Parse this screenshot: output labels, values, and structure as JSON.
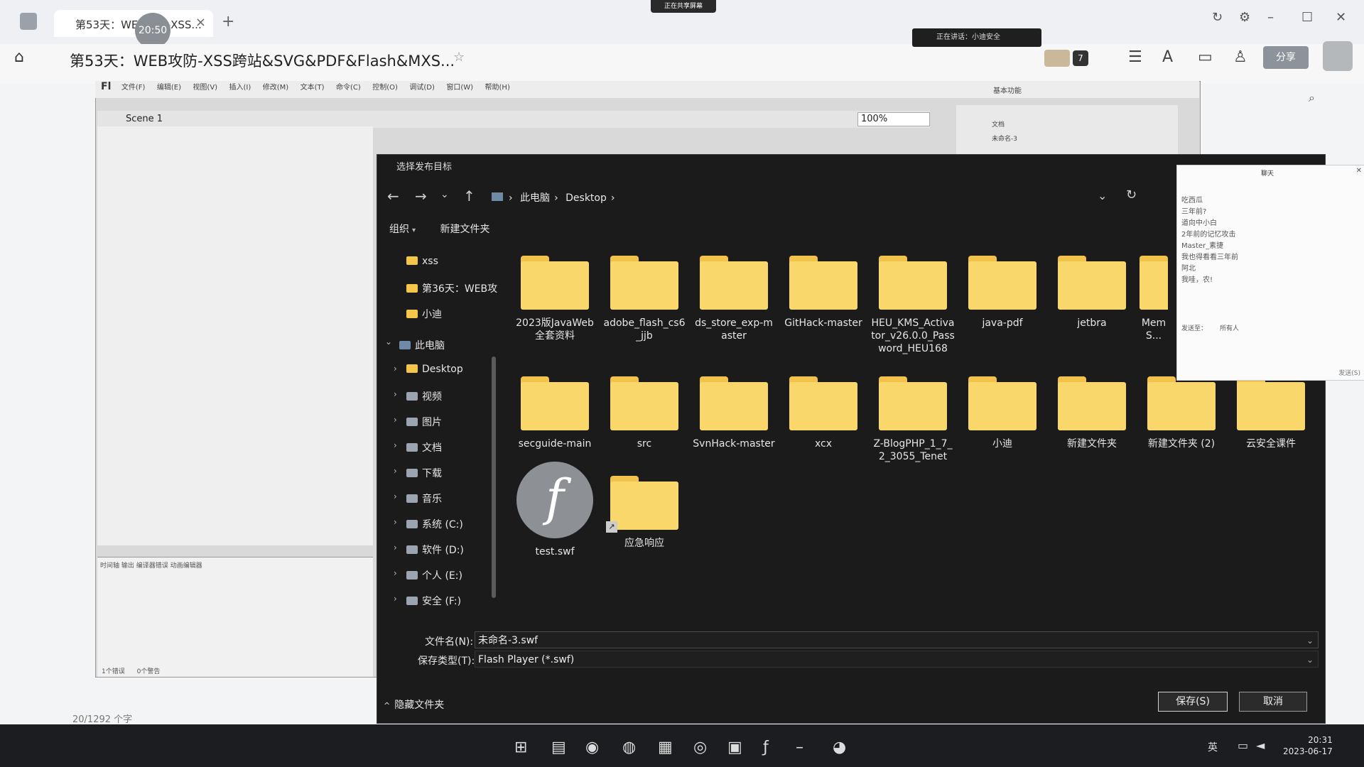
{
  "browser": {
    "tab_title": "第53天：WEB攻防-XSS...",
    "timer": "20:50",
    "share_banner": "正在共享屏幕"
  },
  "doc": {
    "title": "第53天：WEB攻防-XSS跨站&SVG&PDF&Flash&MXS...",
    "speaking": "正在讲话：小迪安全",
    "participant_count": "7",
    "share_button": "分享",
    "status_words": "20/1292 个字"
  },
  "flash": {
    "menu": [
      "文件(F)",
      "编辑(E)",
      "视图(V)",
      "插入(I)",
      "修改(M)",
      "文本(T)",
      "命令(C)",
      "控制(O)",
      "调试(D)",
      "窗口(W)",
      "帮助(H)"
    ],
    "workspace": "基本功能",
    "scene": "Scene 1",
    "zoom": "100%",
    "timeline_tabs": [
      "时间轴",
      "输出",
      "编译器错误",
      "动画编辑器"
    ],
    "errors_label": "1个错误",
    "warnings_label": "0个警告",
    "props_doc": "文档",
    "props_name": "未命名-3"
  },
  "dialog": {
    "title": "选择发布目标",
    "breadcrumb": [
      "此电脑",
      "Desktop"
    ],
    "organize": "组织",
    "new_folder": "新建文件夹",
    "sidebar": [
      {
        "label": "xss",
        "type": "folder"
      },
      {
        "label": "第36天：WEB攻",
        "type": "folder"
      },
      {
        "label": "小迪",
        "type": "folder"
      },
      {
        "label": "此电脑",
        "type": "pc"
      },
      {
        "label": "Desktop",
        "type": "folder"
      },
      {
        "label": "视频",
        "type": "media"
      },
      {
        "label": "图片",
        "type": "media"
      },
      {
        "label": "文档",
        "type": "media"
      },
      {
        "label": "下载",
        "type": "media"
      },
      {
        "label": "音乐",
        "type": "media"
      },
      {
        "label": "系统 (C:)",
        "type": "drive"
      },
      {
        "label": "软件 (D:)",
        "type": "drive"
      },
      {
        "label": "个人 (E:)",
        "type": "drive"
      },
      {
        "label": "安全 (F:)",
        "type": "drive"
      }
    ],
    "files": [
      "2023版JavaWeb全套资料",
      "adobe_flash_cs6_jjb",
      "ds_store_exp-master",
      "GitHack-master",
      "HEU_KMS_Activator_v26.0.0_Password_HEU168",
      "java-pdf",
      "jetbra",
      "MemS...",
      "secguide-main",
      "src",
      "SvnHack-master",
      "xcx",
      "Z-BlogPHP_1_7_2_3055_Tenet",
      "小迪",
      "新建文件夹",
      "新建文件夹 (2)",
      "云安全课件",
      "test.swf",
      "应急响应"
    ],
    "filename_label": "文件名(N):",
    "filename_value": "未命名-3.swf",
    "filetype_label": "保存类型(T):",
    "filetype_value": "Flash Player (*.swf)",
    "hide_folders": "隐藏文件夹",
    "save": "保存(S)",
    "cancel": "取消"
  },
  "chat": {
    "title": "聊天",
    "messages": [
      "吃西瓜",
      "三年前?",
      "道向中小白",
      "2年前的记忆攻击",
      "Master_素捷",
      "我也得看看三年前",
      "阿北",
      "我哇，农!"
    ],
    "send_to_label": "发送至：",
    "send_to_value": "所有人",
    "send_button": "发送(S)"
  },
  "taskbar": {
    "time": "20:31",
    "date": "2023-06-17",
    "ime": "英"
  }
}
